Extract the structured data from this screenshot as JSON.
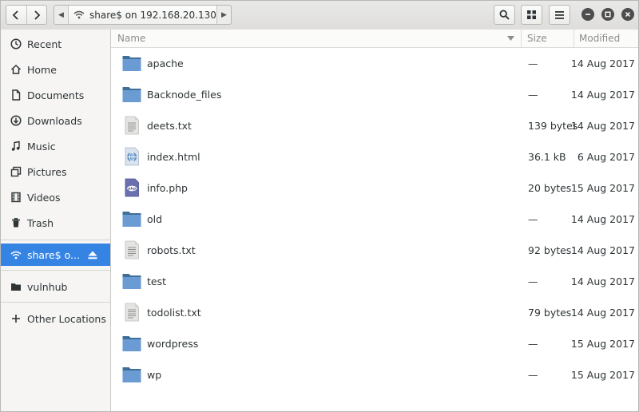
{
  "header": {
    "location_label": "share$ on 192.168.20.130"
  },
  "sidebar": {
    "items": [
      {
        "label": "Recent",
        "icon": "clock-icon"
      },
      {
        "label": "Home",
        "icon": "home-icon"
      },
      {
        "label": "Documents",
        "icon": "document-icon"
      },
      {
        "label": "Downloads",
        "icon": "download-icon"
      },
      {
        "label": "Music",
        "icon": "music-icon"
      },
      {
        "label": "Pictures",
        "icon": "pictures-icon"
      },
      {
        "label": "Videos",
        "icon": "video-icon"
      },
      {
        "label": "Trash",
        "icon": "trash-icon"
      }
    ],
    "network_item": {
      "label": "share$ o...",
      "icon": "wifi-icon"
    },
    "bookmark": {
      "label": "vulnhub",
      "icon": "folder-icon"
    },
    "other_locations": {
      "label": "Other Locations",
      "icon": "plus-icon"
    }
  },
  "list": {
    "columns": {
      "name": "Name",
      "size": "Size",
      "modified": "Modified"
    },
    "files": [
      {
        "name": "apache",
        "size": "—",
        "modified": "14 Aug 2017",
        "type": "folder"
      },
      {
        "name": "Backnode_files",
        "size": "—",
        "modified": "14 Aug 2017",
        "type": "folder"
      },
      {
        "name": "deets.txt",
        "size": "139 bytes",
        "modified": "14 Aug 2017",
        "type": "text"
      },
      {
        "name": "index.html",
        "size": "36.1 kB",
        "modified": "6 Aug 2017",
        "type": "html"
      },
      {
        "name": "info.php",
        "size": "20 bytes",
        "modified": "15 Aug 2017",
        "type": "php"
      },
      {
        "name": "old",
        "size": "—",
        "modified": "14 Aug 2017",
        "type": "folder"
      },
      {
        "name": "robots.txt",
        "size": "92 bytes",
        "modified": "14 Aug 2017",
        "type": "text"
      },
      {
        "name": "test",
        "size": "—",
        "modified": "14 Aug 2017",
        "type": "folder"
      },
      {
        "name": "todolist.txt",
        "size": "79 bytes",
        "modified": "14 Aug 2017",
        "type": "text"
      },
      {
        "name": "wordpress",
        "size": "—",
        "modified": "15 Aug 2017",
        "type": "folder"
      },
      {
        "name": "wp",
        "size": "—",
        "modified": "15 Aug 2017",
        "type": "folder"
      }
    ]
  },
  "colors": {
    "accent": "#3584e4",
    "folder": "#6b9bd3",
    "folder_dark": "#3f6f99"
  }
}
